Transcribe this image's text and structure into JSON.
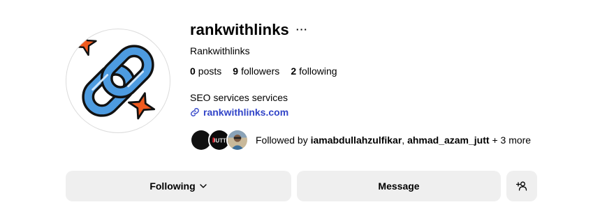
{
  "profile": {
    "username": "rankwithlinks",
    "more_icon": "ellipsis-icon",
    "more_label": "···",
    "display_name": "Rankwithlinks",
    "stats": [
      {
        "count": "0",
        "label": "posts"
      },
      {
        "count": "9",
        "label": "followers"
      },
      {
        "count": "2",
        "label": "following"
      }
    ],
    "bio": "SEO services services",
    "link": {
      "icon": "link-icon",
      "text": "rankwithlinks.com"
    },
    "followed_by": {
      "prefix": "Followed by",
      "users": [
        "iamabdullahzulfikar",
        "ahmad_azam_jutt"
      ],
      "separator": ",",
      "suffix": "+ 3 more",
      "avatar_label": "JUTT"
    },
    "avatar_icon": "chain-link-logo-icon"
  },
  "actions": {
    "following_label": "Following",
    "message_label": "Message",
    "add_user_icon": "add-user-icon"
  },
  "colors": {
    "link": "#3245c8",
    "button_bg": "#efefef",
    "chain_blue": "#4d9be0",
    "spark_orange": "#f05a1e"
  }
}
